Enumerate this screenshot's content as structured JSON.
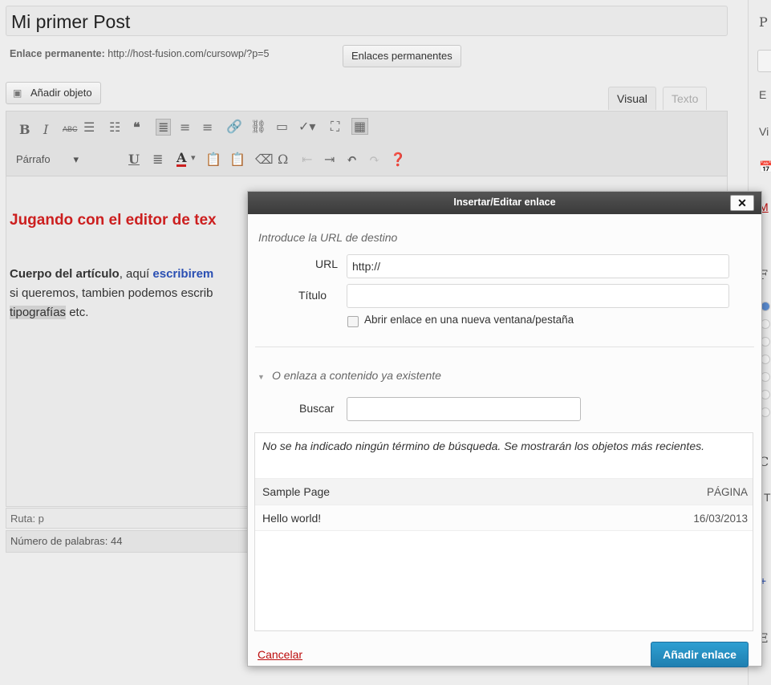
{
  "editor": {
    "post_title": "Mi primer Post",
    "permalink_label": "Enlace permanente:",
    "permalink_url": "http://host-fusion.com/cursowp/?p=5",
    "permalink_button": "Enlaces permanentes",
    "add_media_label": "Añadir objeto",
    "tabs": {
      "visual": "Visual",
      "text": "Texto"
    },
    "toolbar": {
      "bold": "B",
      "italic": "I",
      "strike": "ABC",
      "format_select": "Párrafo",
      "underline": "U",
      "omega": "Ω"
    },
    "content": {
      "heading": "Jugando con el editor de tex",
      "para1_bold": "Cuerpo del artículo",
      "para1_rest": ", aquí ",
      "para1_link": "escribirem",
      "para2": "si queremos, tambien podemos escrib",
      "para3_highlight": "tipografías",
      "para3_rest": " etc."
    },
    "path": "Ruta: p",
    "word_count": "Número de palabras: 44"
  },
  "sidebar": {
    "letters": [
      "P",
      "E",
      "Vi",
      "M",
      "F",
      "C",
      "T",
      "+",
      "E"
    ]
  },
  "dialog": {
    "title": "Insertar/Editar enlace",
    "close_label": "✕",
    "intro": "Introduce la URL de destino",
    "url_label": "URL",
    "url_value": "http://",
    "title_label": "Título",
    "title_value": "",
    "new_tab_label": "Abrir enlace en una nueva ventana/pestaña",
    "existing_toggle": "O enlaza a contenido ya existente",
    "search_label": "Buscar",
    "search_value": "",
    "notice": "No se ha indicado ningún término de búsqueda. Se mostrarán los objetos más recientes.",
    "results": [
      {
        "title": "Sample Page",
        "info": "PÁGINA"
      },
      {
        "title": "Hello world!",
        "info": "16/03/2013"
      }
    ],
    "cancel_label": "Cancelar",
    "submit_label": "Añadir enlace"
  }
}
